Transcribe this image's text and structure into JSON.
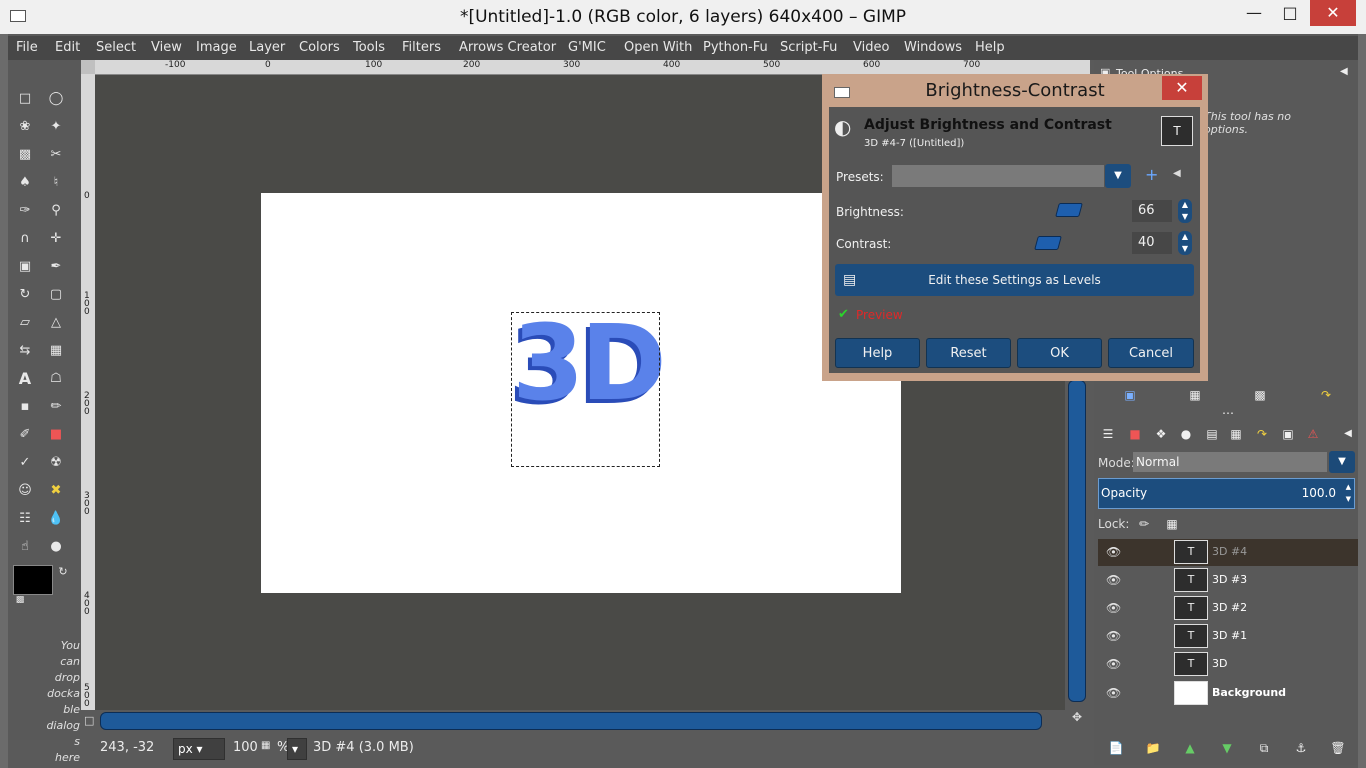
{
  "window": {
    "title": "*[Untitled]-1.0 (RGB color, 6 layers) 640x400 – GIMP",
    "minimize_icon": "minimize-icon",
    "maximize_icon": "maximize-icon",
    "close_icon": "close-icon"
  },
  "menu": [
    {
      "label": "File"
    },
    {
      "label": "Edit"
    },
    {
      "label": "Select"
    },
    {
      "label": "View"
    },
    {
      "label": "Image"
    },
    {
      "label": "Layer"
    },
    {
      "label": "Colors"
    },
    {
      "label": "Tools"
    },
    {
      "label": "Filters"
    },
    {
      "label": "Arrows Creator"
    },
    {
      "label": "G'MIC"
    },
    {
      "label": "Open With"
    },
    {
      "label": "Python-Fu"
    },
    {
      "label": "Script-Fu"
    },
    {
      "label": "Video"
    },
    {
      "label": "Windows"
    },
    {
      "label": "Help"
    }
  ],
  "rulers": {
    "top_ticks": [
      "-100",
      "0",
      "100",
      "200",
      "300",
      "400",
      "500",
      "600",
      "700"
    ],
    "left_ticks": [
      "0",
      "1\n0\n0",
      "2\n0\n0",
      "3\n0\n0",
      "4\n0\n0",
      "5\n0\n0"
    ]
  },
  "canvas": {
    "text_layer_content": "3D",
    "image_bg": "#ffffff",
    "text_color": "#5a82ea"
  },
  "toolbox": {
    "hint": "You can drop dockable dialogs here"
  },
  "status": {
    "coords": "243, -32",
    "unit": "px",
    "zoom": "100",
    "zoom_suffix": "%",
    "layer_info": "3D #4 (3.0 MB)"
  },
  "dock": {
    "tool_options_title": "Tool Options",
    "tool_options_hint": "This tool has no options.",
    "mode_label": "Mode:",
    "mode_value": "Normal",
    "opacity_label": "Opacity",
    "opacity_value": "100.0",
    "lock_label": "Lock:",
    "layers": [
      {
        "name": "3D #4",
        "thumb": "T",
        "active": true
      },
      {
        "name": "3D #3",
        "thumb": "T",
        "active": false
      },
      {
        "name": "3D #2",
        "thumb": "T",
        "active": false
      },
      {
        "name": "3D #1",
        "thumb": "T",
        "active": false
      },
      {
        "name": "3D",
        "thumb": "T",
        "active": false
      },
      {
        "name": "Background",
        "thumb": "",
        "active": false
      }
    ]
  },
  "dialog": {
    "title": "Brightness-Contrast",
    "heading": "Adjust Brightness and Contrast",
    "subheading": "3D #4-7 ([Untitled])",
    "presets_label": "Presets:",
    "brightness_label": "Brightness:",
    "brightness_value": "66",
    "contrast_label": "Contrast:",
    "contrast_value": "40",
    "levels_button": "Edit these Settings as Levels",
    "preview_label": "Preview",
    "buttons": {
      "help": "Help",
      "reset": "Reset",
      "ok": "OK",
      "cancel": "Cancel"
    }
  }
}
